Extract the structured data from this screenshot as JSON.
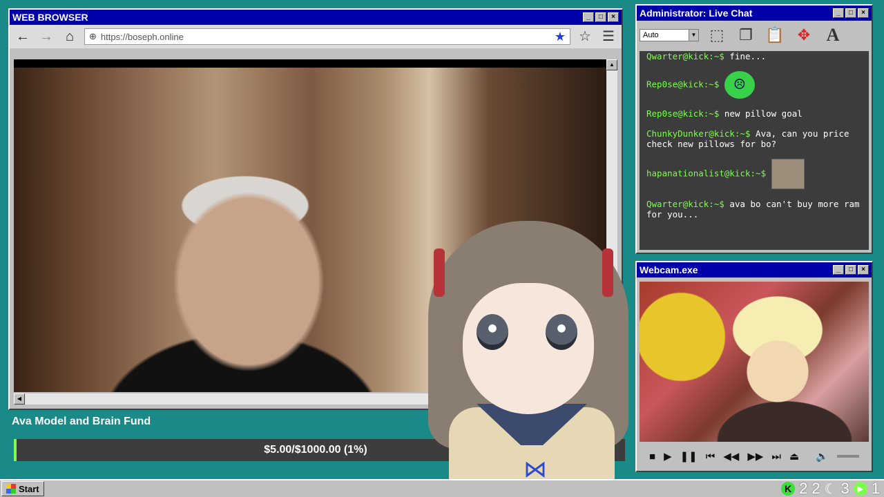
{
  "browser": {
    "title": "WEB BROWSER",
    "url": "https://boseph.online"
  },
  "chat": {
    "title": "Administrator: Live Chat",
    "font_select": "Auto",
    "messages": [
      {
        "user": "Qwarter@kick:~$",
        "text": "fine..."
      },
      {
        "user": "Rep0se@kick:~$",
        "text": "",
        "attachment": "sick-face-emoji"
      },
      {
        "user": "Rep0se@kick:~$",
        "text": "new pillow goal"
      },
      {
        "user": "ChunkyDunker@kick:~$",
        "text": "Ava, can you price check new pillows for bo?"
      },
      {
        "user": "hapanationalist@kick:~$",
        "text": "",
        "attachment": "image-thumbnail"
      },
      {
        "user": "Qwarter@kick:~$",
        "text": "ava bo can't buy more ram for you..."
      }
    ]
  },
  "webcam": {
    "title": "Webcam.exe"
  },
  "fund": {
    "title": "Ava Model and Brain Fund",
    "progress_text": "$5.00/$1000.00 (1%)",
    "progress_fraction": 0.005,
    "accent": "#7cff4a"
  },
  "taskbar": {
    "start_label": "Start",
    "tray": {
      "kick_count": "2",
      "count_a": "2",
      "moon_count": "3",
      "play_count": "1"
    }
  }
}
